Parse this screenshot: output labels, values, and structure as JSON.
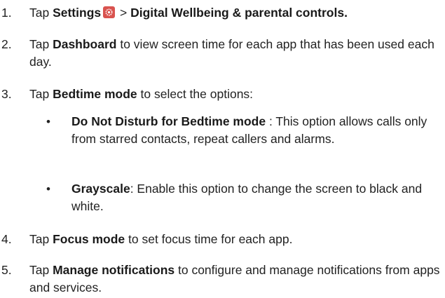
{
  "steps": [
    {
      "num": "1.",
      "pre": "Tap ",
      "bold": "Settings",
      "icon": "settings-gear-icon",
      "sep": " > ",
      "bold2": "Digital Wellbeing & parental controls."
    },
    {
      "num": "2.",
      "pre": "Tap ",
      "bold": "Dashboard",
      "post": " to view screen time for each app that has been used each day."
    },
    {
      "num": "3.",
      "pre": "Tap ",
      "bold": "Bedtime mode",
      "post": " to select the options:"
    },
    {
      "num": "4.",
      "pre": "Tap ",
      "bold": "Focus mode",
      "post": " to set focus time for each app."
    },
    {
      "num": "5.",
      "pre": "Tap ",
      "bold": "Manage notifications",
      "post": " to configure and manage notifications from apps and services."
    }
  ],
  "bullets": [
    {
      "symbol": "•",
      "bold": "Do Not Disturb for Bedtime mode",
      "post": " : This option allows calls only from starred contacts, repeat callers and alarms."
    },
    {
      "symbol": "•",
      "bold": "Grayscale",
      "post": ": Enable this option to change the screen to black and white."
    }
  ],
  "colors": {
    "settings_icon_bg": "#d9534f"
  }
}
